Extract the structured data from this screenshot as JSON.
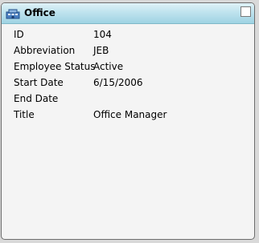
{
  "panel": {
    "title": "Office",
    "icon": "office-building-icon",
    "fields": [
      {
        "label": "ID",
        "value": "104"
      },
      {
        "label": "Abbreviation",
        "value": "JEB"
      },
      {
        "label": "Employee Status",
        "value": "Active"
      },
      {
        "label": "Start Date",
        "value": "6/15/2006"
      },
      {
        "label": "End Date",
        "value": ""
      },
      {
        "label": "Title",
        "value": "Office Manager"
      }
    ]
  },
  "colors": {
    "header_gradient_top": "#dff2f7",
    "header_gradient_bottom": "#9fd3e3",
    "panel_background": "#f4f4f4",
    "border": "#6d6d6d"
  }
}
